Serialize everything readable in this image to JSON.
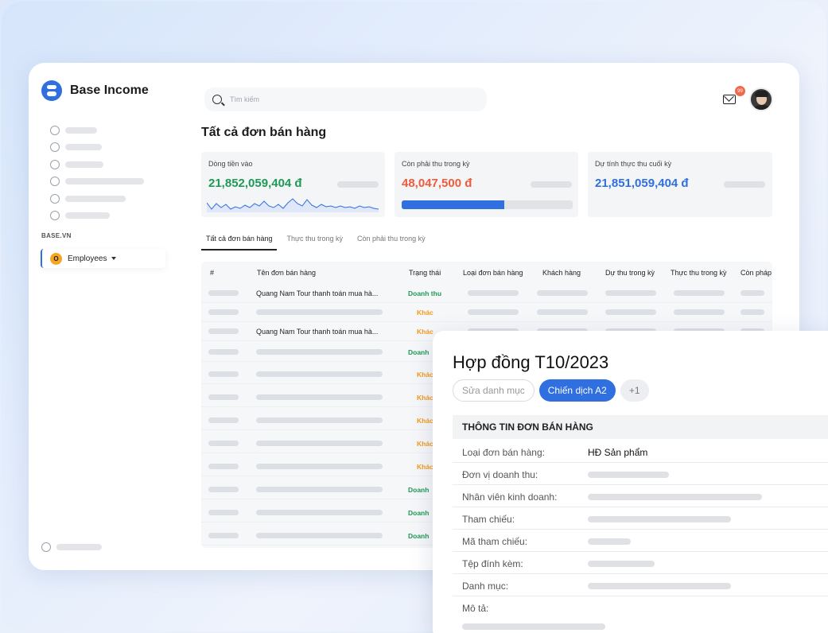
{
  "app": {
    "name": "Base Income"
  },
  "sidebar": {
    "section_label": "BASE.VN",
    "workspace": {
      "badge": "O",
      "label": "Employees"
    }
  },
  "header": {
    "search_placeholder": "Tìm kiếm",
    "notification_count": "99"
  },
  "page": {
    "title": "Tất cả đơn bán hàng"
  },
  "kpis": [
    {
      "label": "Dòng tiền vào",
      "value": "21,852,059,404 đ",
      "color": "#1f9a55"
    },
    {
      "label": "Còn phải thu trong kỳ",
      "value": "48,047,500 đ",
      "color": "#ef5b3c",
      "progress": 0.6
    },
    {
      "label": "Dự tính thực thu cuối kỳ",
      "value": "21,851,059,404 đ",
      "color": "#2f6fe0"
    }
  ],
  "tabs": [
    "Tất cả đơn bán hàng",
    "Thực thu trong kỳ",
    "Còn phải thu trong kỳ"
  ],
  "table": {
    "columns": [
      "#",
      "Tên đơn bán hàng",
      "Trạng thái",
      "Loại đơn bán hàng",
      "Khách hàng",
      "Dự thu trong kỳ",
      "Thực thu trong kỳ",
      "Còn pháp"
    ],
    "rows": [
      {
        "name": "Quang Nam Tour thanh toán mua hà...",
        "status": "Doanh thu"
      },
      {
        "name": "",
        "status": "Khác"
      },
      {
        "name": "Quang Nam Tour thanh toán mua hà...",
        "status": "Khác"
      },
      {
        "name": "",
        "status": "Doanh"
      },
      {
        "name": "",
        "status": "Khác"
      },
      {
        "name": "",
        "status": "Khác"
      },
      {
        "name": "",
        "status": "Khác"
      },
      {
        "name": "",
        "status": "Khác"
      },
      {
        "name": "",
        "status": "Khác"
      },
      {
        "name": "",
        "status": "Doanh"
      },
      {
        "name": "",
        "status": "Doanh"
      },
      {
        "name": "",
        "status": "Doanh"
      }
    ]
  },
  "colors": {
    "accent": "#2f6fe0",
    "revenue": "#1f9a55",
    "other": "#f29a1b"
  },
  "detail": {
    "title": "Hợp đồng T10/2023",
    "chips": [
      "Sửa danh mục",
      "Chiến dịch A2",
      "+1"
    ],
    "section": "THÔNG TIN ĐƠN BÁN HÀNG",
    "fields": [
      {
        "label": "Loại đơn bán hàng:",
        "value": "HĐ Sản phẩm"
      },
      {
        "label": "Đơn vị doanh thu:",
        "value": ""
      },
      {
        "label": "Nhân viên kinh doanh:",
        "value": ""
      },
      {
        "label": "Tham chiếu:",
        "value": ""
      },
      {
        "label": "Mã tham chiếu:",
        "value": ""
      },
      {
        "label": "Tệp đính kèm:",
        "value": ""
      },
      {
        "label": "Danh mục:",
        "value": ""
      },
      {
        "label": "Mô tả:",
        "value": ""
      }
    ]
  }
}
